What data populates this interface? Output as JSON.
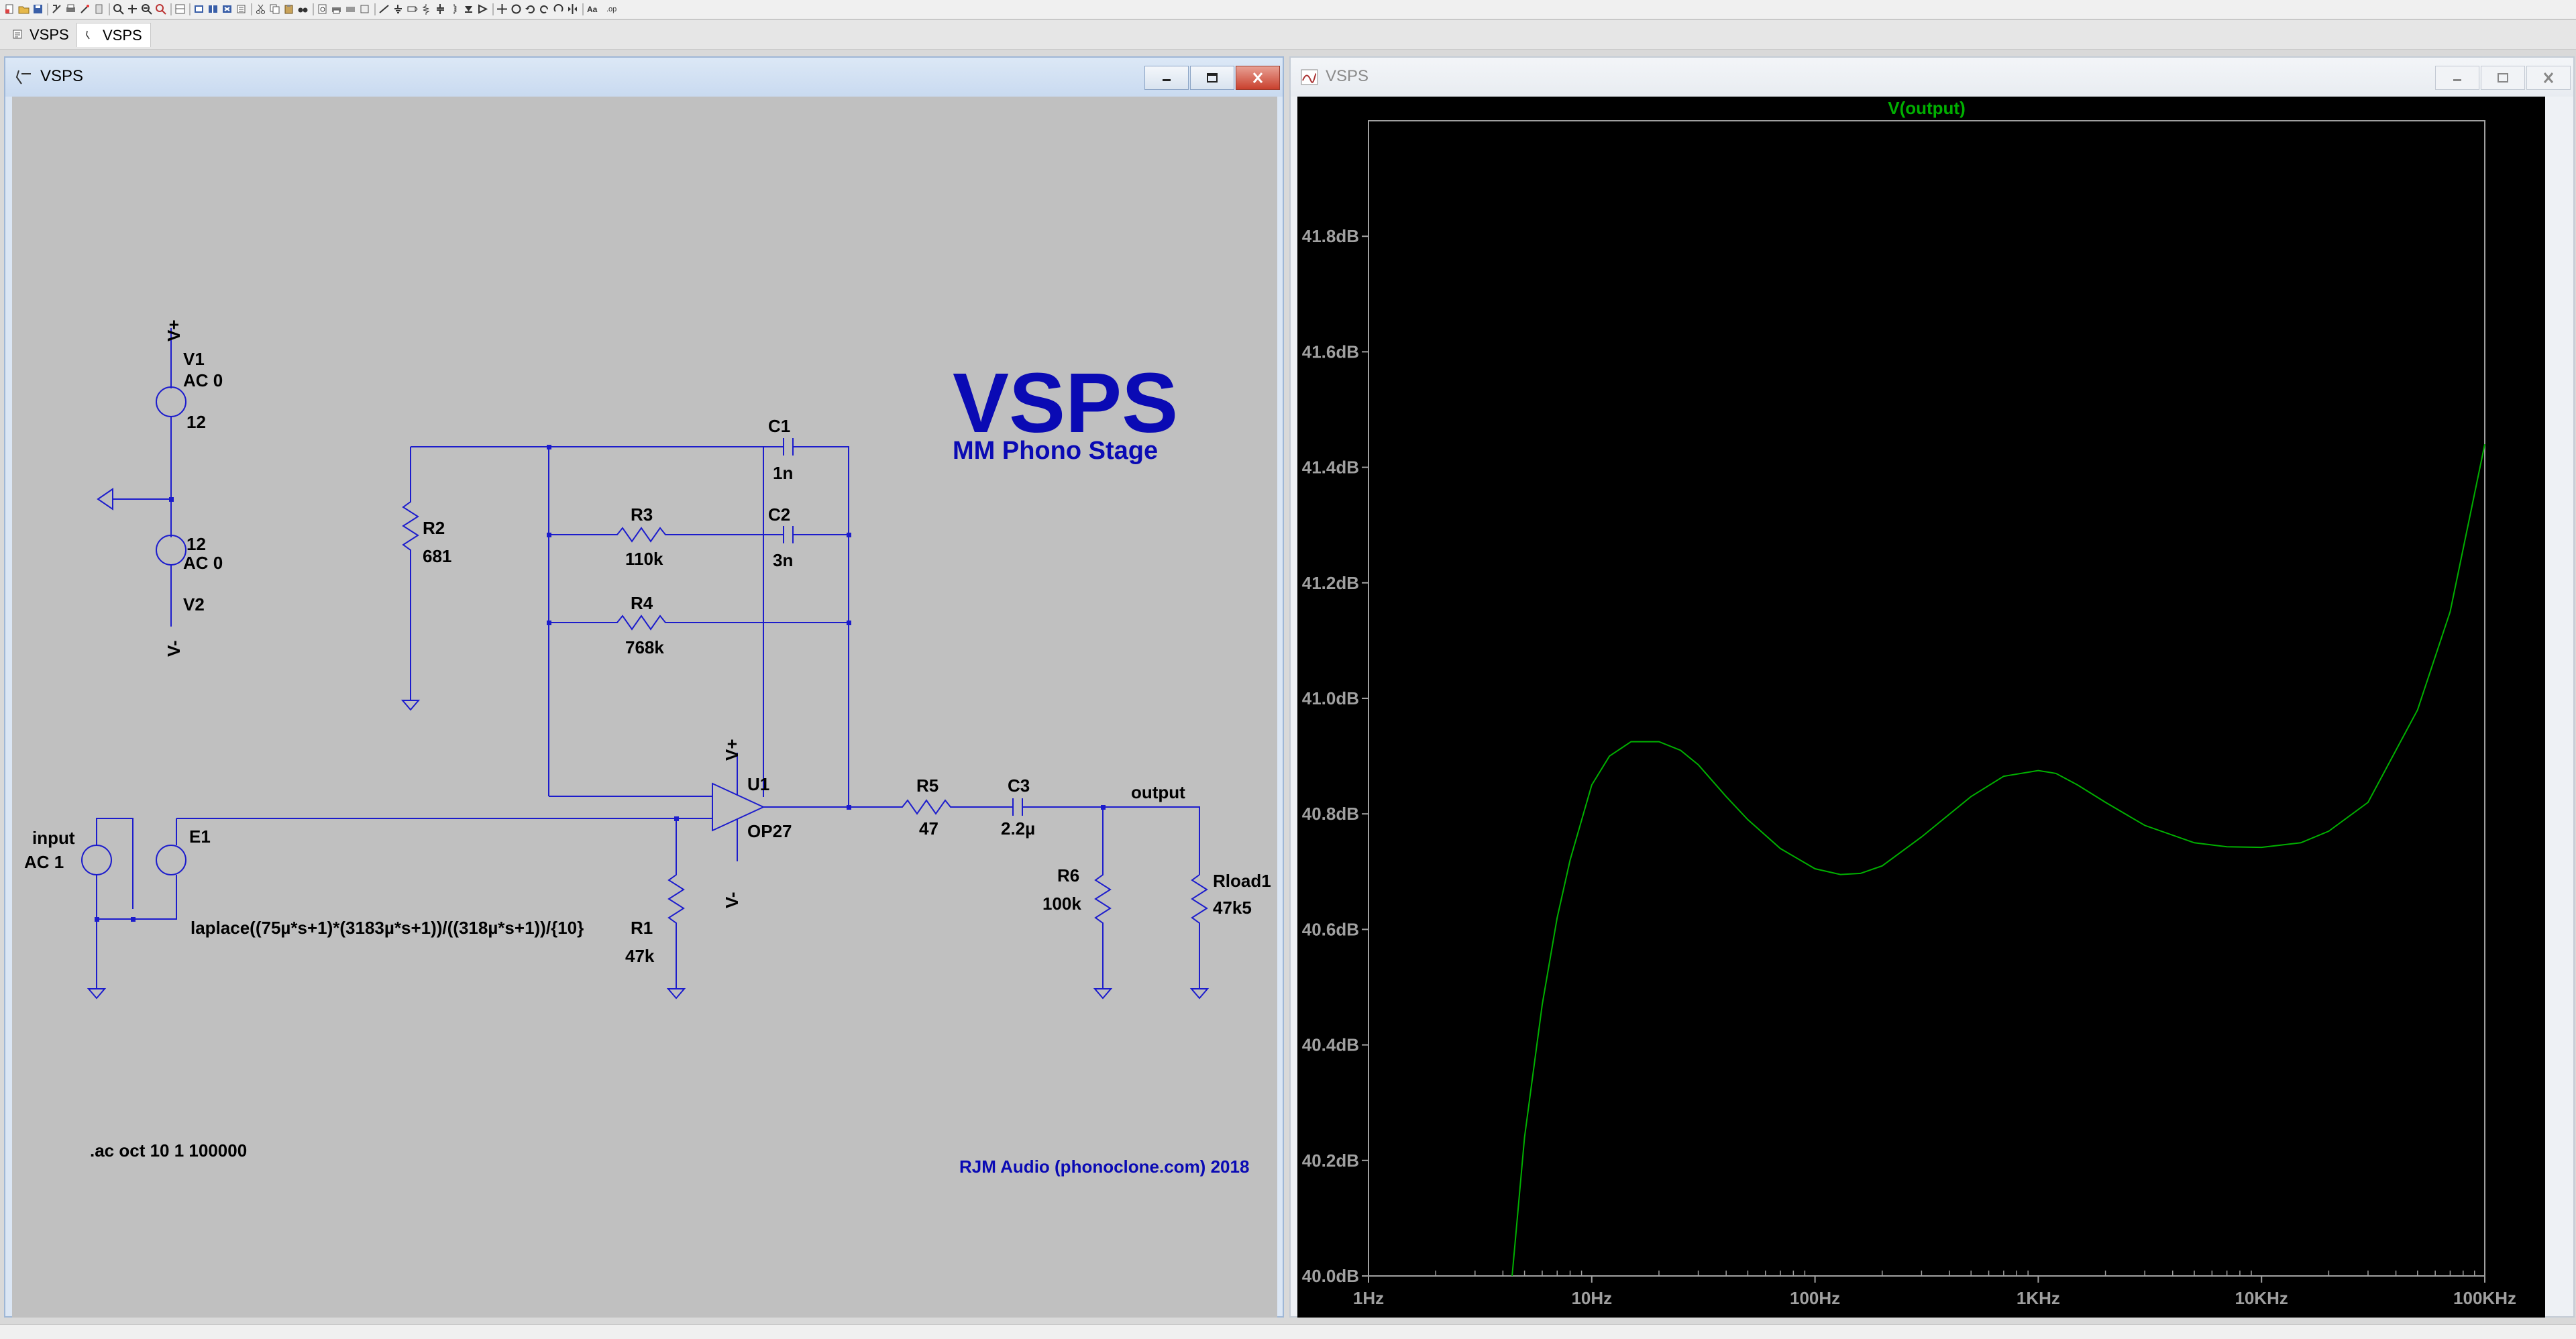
{
  "tabs": [
    {
      "label": "VSPS",
      "active": false
    },
    {
      "label": "VSPS",
      "active": true
    }
  ],
  "schematic_window": {
    "title": "VSPS",
    "labels": {
      "title": "VSPS",
      "subtitle": "MM Phono Stage",
      "credit": "RJM Audio (phonoclone.com) 2018",
      "directive": ".ac oct 10 1 100000",
      "v1_name": "V1",
      "v1_ac": "AC 0",
      "v1_val": "12",
      "v2_name": "V2",
      "v2_ac": "AC 0",
      "v2_val": "12",
      "vplus": "V+",
      "vminus": "V-",
      "r2_name": "R2",
      "r2_val": "681",
      "c1_name": "C1",
      "c1_val": "1n",
      "r3_name": "R3",
      "r3_val": "110k",
      "c2_name": "C2",
      "c2_val": "3n",
      "r4_name": "R4",
      "r4_val": "768k",
      "u1_name": "U1",
      "u1_val": "OP27",
      "r5_name": "R5",
      "r5_val": "47",
      "c3_name": "C3",
      "c3_val": "2.2µ",
      "output_label": "output",
      "r6_name": "R6",
      "r6_val": "100k",
      "rload_name": "Rload1",
      "rload_val": "47k5",
      "r1_name": "R1",
      "r1_val": "47k",
      "input_name": "input",
      "input_ac": "AC 1",
      "e1_name": "E1",
      "laplace": "laplace((75µ*s+1)*(3183µ*s+1))/((318µ*s+1))/{10}"
    }
  },
  "plot_window": {
    "title": "VSPS"
  },
  "colors": {
    "wire": "#1c1ccc",
    "title_text": "#0a0ab4",
    "plot_bg": "#000000",
    "trace": "#00b000",
    "axis": "#a0a0a0",
    "window_close": "#c9402d"
  },
  "chart_data": {
    "type": "line",
    "title": "V(output)",
    "x_scale": "log",
    "xlim": [
      1,
      100000
    ],
    "ylim": [
      40.0,
      42.0
    ],
    "x_ticks": [
      "1Hz",
      "10Hz",
      "100Hz",
      "1KHz",
      "10KHz",
      "100KHz"
    ],
    "y_ticks": [
      "40.0dB",
      "40.2dB",
      "40.4dB",
      "40.6dB",
      "40.8dB",
      "41.0dB",
      "41.2dB",
      "41.4dB",
      "41.6dB",
      "41.8dB"
    ],
    "series": [
      {
        "name": "V(output)",
        "x": [
          4.4,
          5,
          6,
          7,
          8,
          10,
          12,
          15,
          20,
          25,
          30,
          40,
          50,
          70,
          100,
          130,
          160,
          200,
          300,
          500,
          700,
          1000,
          1200,
          1500,
          2000,
          3000,
          5000,
          7000,
          10000,
          15000,
          20000,
          30000,
          50000,
          70000,
          100000
        ],
        "y": [
          40.0,
          40.24,
          40.47,
          40.62,
          40.72,
          40.85,
          40.9,
          40.925,
          40.925,
          40.91,
          40.885,
          40.83,
          40.79,
          40.74,
          40.705,
          40.695,
          40.697,
          40.71,
          40.76,
          40.83,
          40.865,
          40.875,
          40.87,
          40.85,
          40.82,
          40.78,
          40.75,
          40.743,
          40.742,
          40.75,
          40.77,
          40.82,
          40.98,
          41.15,
          41.44
        ]
      }
    ]
  }
}
